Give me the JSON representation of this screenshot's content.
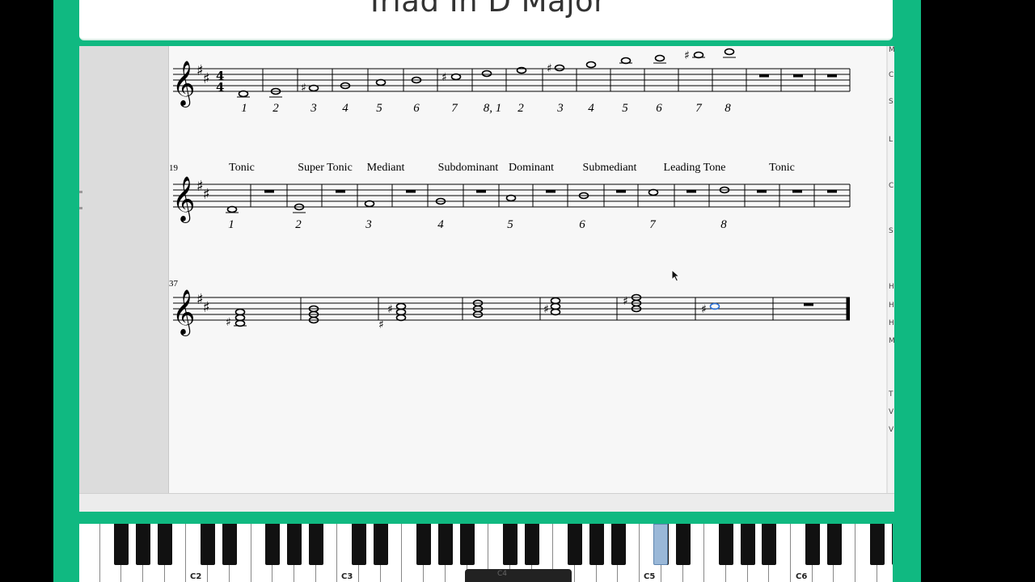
{
  "title": "Triad In D Major",
  "score": {
    "system1": {
      "time_signature": "4/4",
      "scale_degrees": [
        "1",
        "2",
        "3",
        "4",
        "5",
        "6",
        "7",
        "8, 1",
        "2",
        "3",
        "4",
        "5",
        "6",
        "7",
        "8"
      ]
    },
    "system2": {
      "measure_number": "19",
      "labels": [
        "Tonic",
        "Super Tonic",
        "Mediant",
        "Subdominant",
        "Dominant",
        "Submediant",
        "Leading Tone",
        "Tonic"
      ],
      "scale_degrees": [
        "1",
        "2",
        "3",
        "4",
        "5",
        "6",
        "7",
        "8"
      ]
    },
    "system3": {
      "measure_number": "37"
    }
  },
  "right_bar_letters": [
    "M",
    "C",
    "S",
    "L",
    "C",
    "S",
    "H",
    "H",
    "H",
    "M",
    "T",
    "V",
    "V"
  ],
  "piano": {
    "octave_labels": [
      "C2",
      "C3",
      "C4",
      "C5",
      "C6"
    ],
    "highlighted_key_color": "#9ab8d8"
  },
  "colors": {
    "frame": "#10b981",
    "selected_note": "#2a6fd6"
  }
}
